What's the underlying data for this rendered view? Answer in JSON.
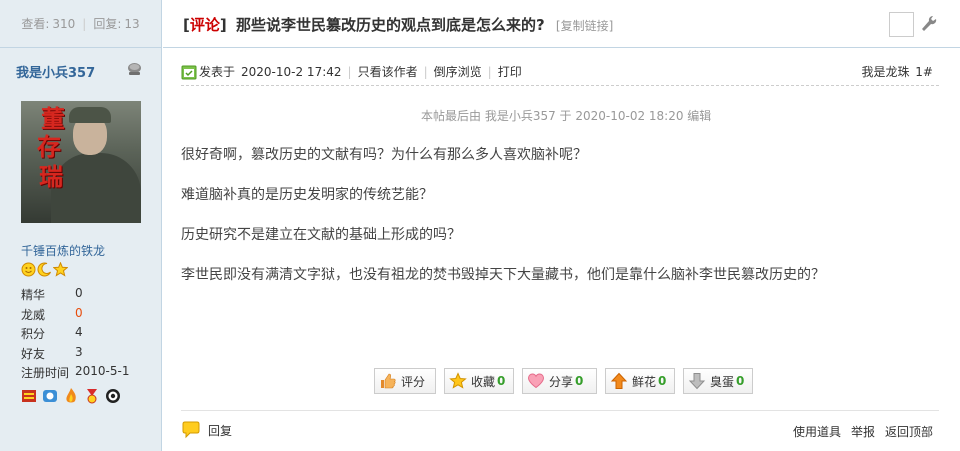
{
  "stats": {
    "views_label": "查看:",
    "views": "310",
    "replies_label": "回复:",
    "replies": "13"
  },
  "thread": {
    "open_bracket": "[",
    "tag": "评论",
    "close_bracket": "]",
    "title": "那些说李世民篡改历史的观点到底是怎么来的?",
    "copy_link": "[复制链接]"
  },
  "author": {
    "name": "我是小兵357",
    "avatar_text": [
      "董",
      "存",
      "瑞"
    ],
    "rank": "千锤百炼的铁龙",
    "fields": [
      {
        "key": "精华",
        "value": "0"
      },
      {
        "key": "龙威",
        "value": "0"
      },
      {
        "key": "积分",
        "value": "4"
      },
      {
        "key": "好友",
        "value": "3"
      },
      {
        "key": "注册时间",
        "value": "2010-5-1"
      }
    ]
  },
  "post": {
    "posted_label": "发表于",
    "posted_at": "2020-10-2 17:42",
    "only_author": "只看该作者",
    "reverse_view": "倒序浏览",
    "print": "打印",
    "floor_name": "我是龙珠",
    "floor_num": "1#",
    "edited_note": "本帖最后由 我是小兵357 于 2020-10-02 18:20 编辑",
    "paragraphs": [
      "很好奇啊，篡改历史的文献有吗？为什么有那么多人喜欢脑补呢？",
      "难道脑补真的是历史发明家的传统艺能？",
      "历史研究不是建立在文献的基础上形成的吗？",
      "李世民即没有满清文字狱，也没有祖龙的焚书毁掉天下大量藏书，他们是靠什么脑补李世民篡改历史的？"
    ]
  },
  "actions": {
    "rate": "评分",
    "favorite": "收藏",
    "favorite_count": "0",
    "share": "分享",
    "share_count": "0",
    "flower": "鲜花",
    "flower_count": "0",
    "egg": "臭蛋",
    "egg_count": "0"
  },
  "footer": {
    "reply": "回复",
    "use_tool": "使用道具",
    "report": "举报",
    "back_to_top": "返回顶部"
  },
  "colors": {
    "sidebar_bg": "#e5edf2",
    "border": "#c2d5e3",
    "username": "#336699",
    "tag": "#cc0000",
    "count": "#369e2b"
  }
}
